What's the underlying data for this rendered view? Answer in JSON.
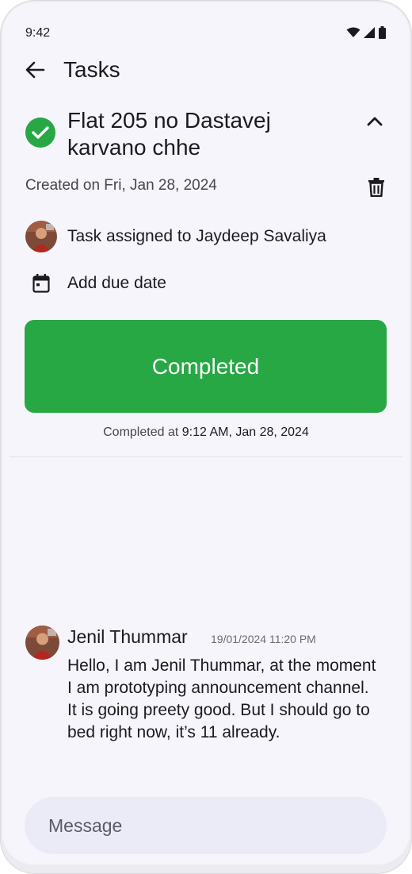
{
  "status_bar": {
    "time": "9:42"
  },
  "app_bar": {
    "title": "Tasks"
  },
  "task": {
    "title": "Flat 205 no Dastavej karvano chhe",
    "created": "Created on Fri, Jan 28, 2024",
    "assignee_text": "Task assigned to Jaydeep Savaliya",
    "due_date_label": "Add due date",
    "status_button": "Completed",
    "completed_prefix": "Completed at ",
    "completed_time": "9:12 AM, Jan 28, 2024"
  },
  "comment": {
    "author": "Jenil Thummar",
    "timestamp": "19/01/2024 11:20 PM",
    "text": "Hello, I am Jenil Thummar, at the moment I am prototyping announcement channel. It is going preety good. But I should go to bed right now, it’s 11 already."
  },
  "composer": {
    "placeholder": "Message"
  },
  "colors": {
    "accent_green": "#28a745",
    "background": "#f6f5fc",
    "input_bg": "#ebeaf7"
  },
  "icons": [
    "wifi-icon",
    "signal-icon",
    "battery-icon",
    "back-arrow-icon",
    "check-icon",
    "chevron-up-icon",
    "trash-icon",
    "calendar-icon"
  ]
}
